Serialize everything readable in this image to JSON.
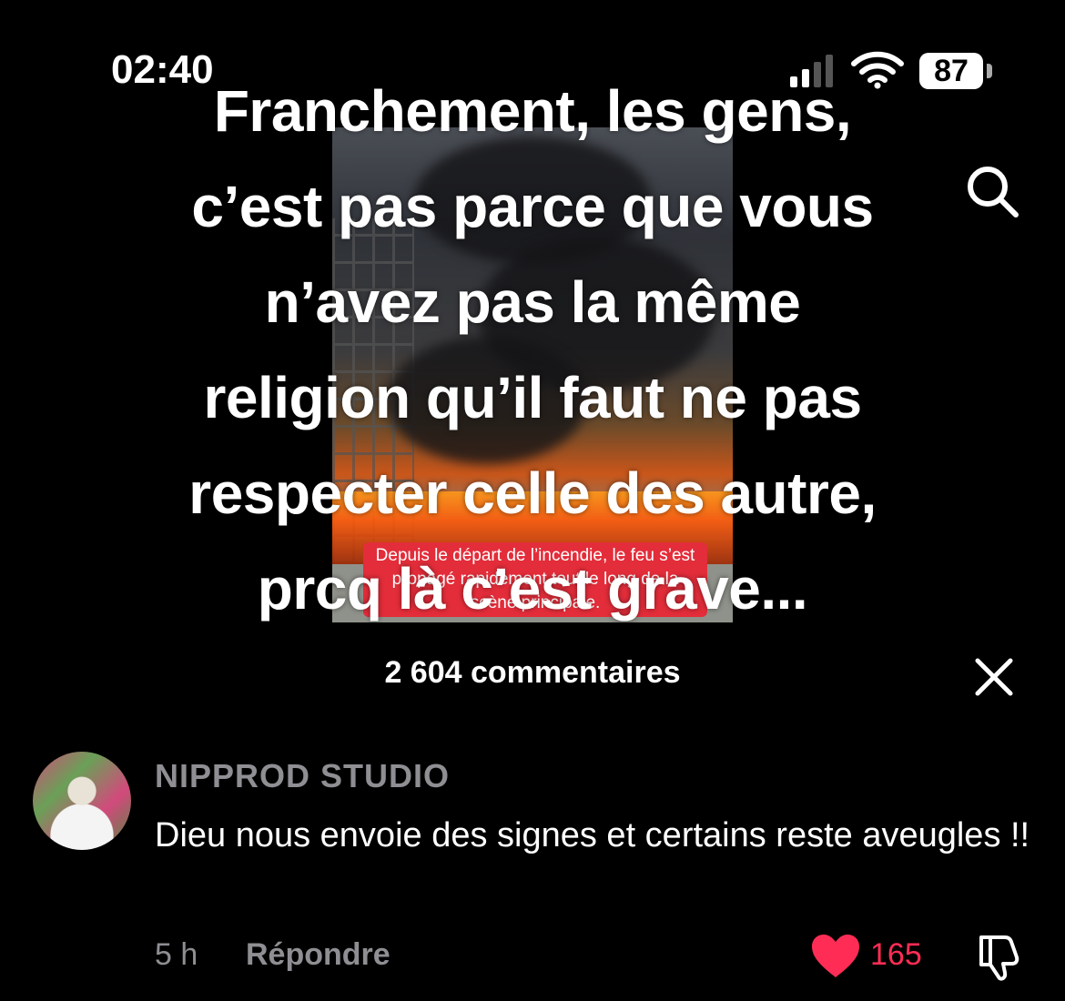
{
  "status_bar": {
    "time": "02:40",
    "battery": "87"
  },
  "overlay_text": {
    "lines": [
      "Franchement, les gens,",
      "c’est pas parce que vous",
      "n’avez pas la même",
      "religion qu’il faut ne pas",
      "respecter celle des autre,",
      "prcq là c’est grave..."
    ]
  },
  "video": {
    "caption": "Depuis le départ de l’incendie, le feu s’est propagé rapidement tout le long de la scène principale."
  },
  "comments_header": {
    "count_label": "2 604 commentaires"
  },
  "comment": {
    "author": "NIPPROD STUDIO",
    "text": "Dieu nous envoie des signes et certains reste aveugles !!",
    "time": "5 h",
    "reply_label": "Répondre",
    "likes": "165",
    "liked": true
  },
  "colors": {
    "like": "#ff2d55",
    "muted": "#8e8e93",
    "caption_bg": "#e32d3a"
  },
  "icons": [
    "signal-icon",
    "wifi-icon",
    "battery-icon",
    "search-icon",
    "close-icon",
    "heart-icon",
    "dislike-icon"
  ]
}
